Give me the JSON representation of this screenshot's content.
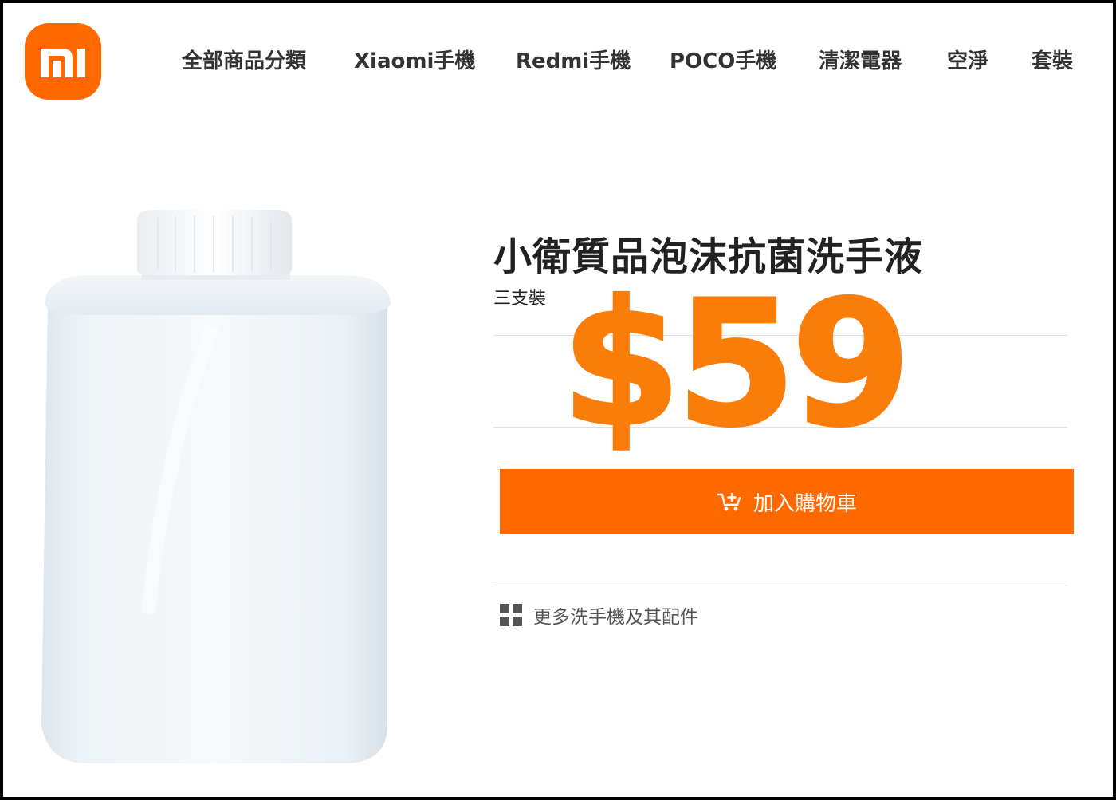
{
  "header": {
    "logo_text": "mi",
    "nav": [
      {
        "label": "全部商品分類"
      },
      {
        "label": "Xiaomi手機"
      },
      {
        "label": "Redmi手機"
      },
      {
        "label": "POCO手機"
      },
      {
        "label": "清潔電器"
      },
      {
        "label": "空淨"
      },
      {
        "label": "套裝"
      }
    ]
  },
  "product": {
    "title": "小衛質品泡沫抗菌洗手液",
    "variant": "三支裝",
    "price": "$59",
    "add_to_cart_label": "加入購物車",
    "more_link_label": "更多洗手機及其配件"
  },
  "icons": {
    "cart": "add-to-cart-icon",
    "grid": "grid-icon"
  },
  "colors": {
    "brand": "#ff6900",
    "price": "#fa7d0a",
    "text": "#222222"
  }
}
